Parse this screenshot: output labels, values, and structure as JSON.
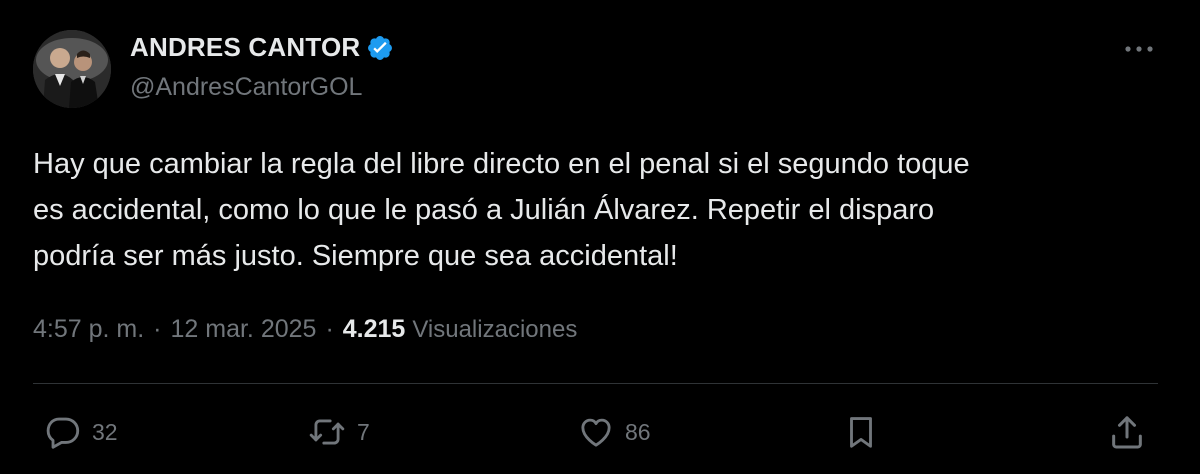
{
  "author": {
    "display_name": "ANDRES CANTOR",
    "handle": "@AndresCantorGOL",
    "verified": true
  },
  "tweet": {
    "text": "Hay que cambiar la regla del libre directo en el penal si el segundo toque\nes accidental, como lo que le pasó a Julián Álvarez. Repetir el disparo\npodría ser más justo. Siempre que sea accidental!",
    "time": "4:57 p. m.",
    "date": "12 mar. 2025",
    "separator": "·",
    "views_count": "4.215",
    "views_label": "Visualizaciones"
  },
  "actions": {
    "reply_count": "32",
    "retweet_count": "7",
    "like_count": "86"
  },
  "icons": {
    "verified": "verified-badge-icon",
    "more": "more-dots-icon",
    "reply": "reply-bubble-icon",
    "retweet": "retweet-arrows-icon",
    "like": "heart-icon",
    "bookmark": "bookmark-icon",
    "share": "share-upload-icon"
  },
  "colors": {
    "background": "#000000",
    "primary_text": "#e7e9ea",
    "secondary_text": "#71767b",
    "divider": "#2f3336",
    "verified_blue": "#1d9bf0"
  }
}
